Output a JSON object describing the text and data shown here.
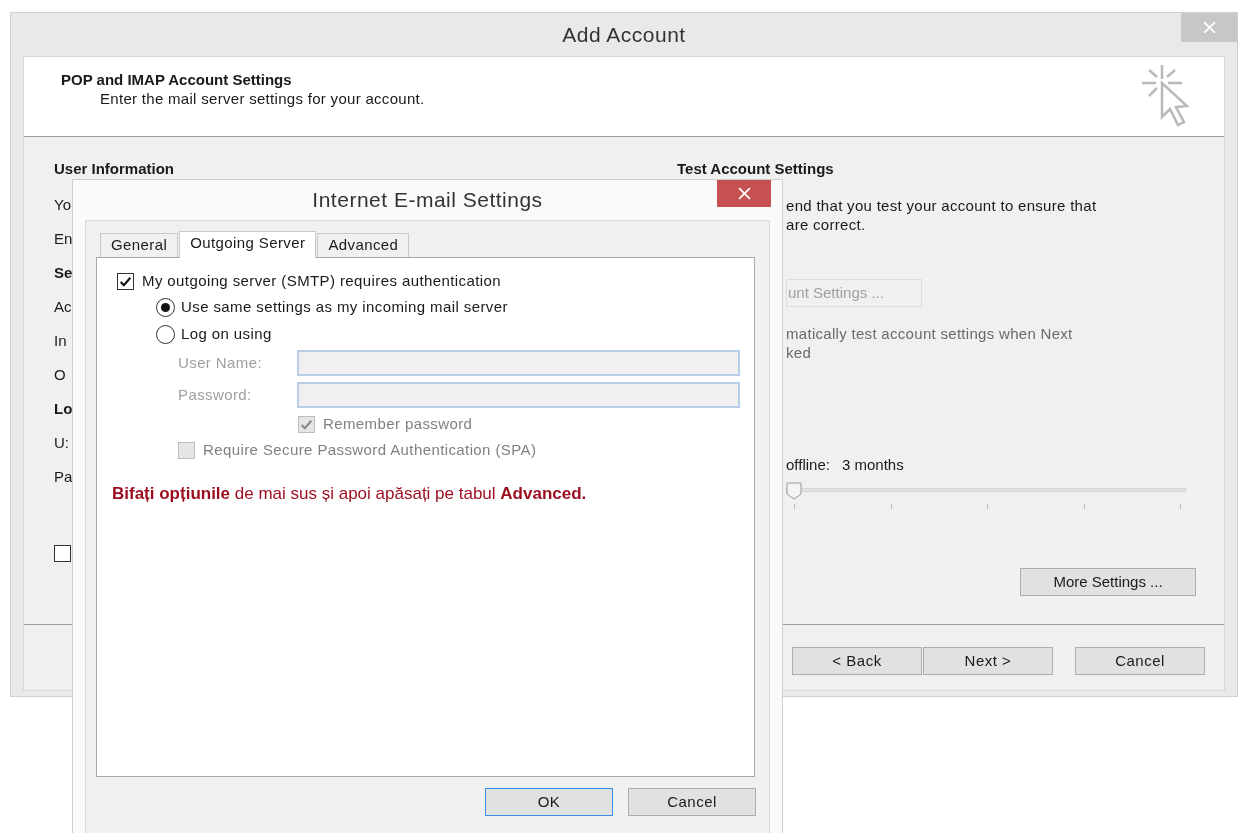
{
  "main_window": {
    "title": "Add Account",
    "header_title": "POP and IMAP Account Settings",
    "header_subtitle": "Enter the mail server settings for your account.",
    "left_heading": "User Information",
    "left_items": [
      {
        "kind": "label",
        "text": "Yo"
      },
      {
        "kind": "label",
        "text": "En"
      },
      {
        "kind": "heading",
        "text": "Se"
      },
      {
        "kind": "label",
        "text": "Ac"
      },
      {
        "kind": "label",
        "text": "In"
      },
      {
        "kind": "label",
        "text": "O"
      },
      {
        "kind": "heading",
        "text": "Lo"
      },
      {
        "kind": "label",
        "text": "U:"
      },
      {
        "kind": "label",
        "text": "Pa"
      },
      {
        "kind": "checkbox",
        "checked": false
      }
    ],
    "right_heading": "Test Account Settings",
    "description_lines": [
      "end that you test your account to ensure that",
      "are correct."
    ],
    "test_button": {
      "label": "unt Settings ...",
      "disabled": true
    },
    "auto_test_lines": [
      "matically test account settings when Next",
      "ked"
    ],
    "offline_label": "offline:",
    "offline_value": "3 months",
    "offline_slider": {
      "level": 0
    },
    "more_settings_button": "More Settings ...",
    "footer_buttons": [
      "< Back",
      "Next >",
      "Cancel"
    ]
  },
  "dialog": {
    "title": "Internet E-mail Settings",
    "tabs": [
      {
        "label": "General",
        "selected": false
      },
      {
        "label": "Outgoing Server",
        "selected": true
      },
      {
        "label": "Advanced",
        "selected": false
      }
    ],
    "requires_auth": {
      "label": "My outgoing server (SMTP) requires authentication",
      "checked": true
    },
    "auth_options": [
      {
        "label": "Use same settings as my incoming mail server",
        "selected": true
      },
      {
        "label": "Log on using",
        "selected": false
      }
    ],
    "fields": [
      {
        "label": "User Name:",
        "disabled": true
      },
      {
        "label": "Password:",
        "disabled": true
      }
    ],
    "remember_password": {
      "label": "Remember password",
      "checked": true,
      "disabled": true
    },
    "spa": {
      "label": "Require Secure Password Authentication (SPA)",
      "checked": false,
      "disabled": true
    },
    "note": "**Bifați opțiunile** de mai sus și apoi apăsați pe tabul **Advanced.**",
    "buttons": [
      {
        "label": "OK",
        "default": true
      },
      {
        "label": "Cancel",
        "default": false
      }
    ]
  }
}
